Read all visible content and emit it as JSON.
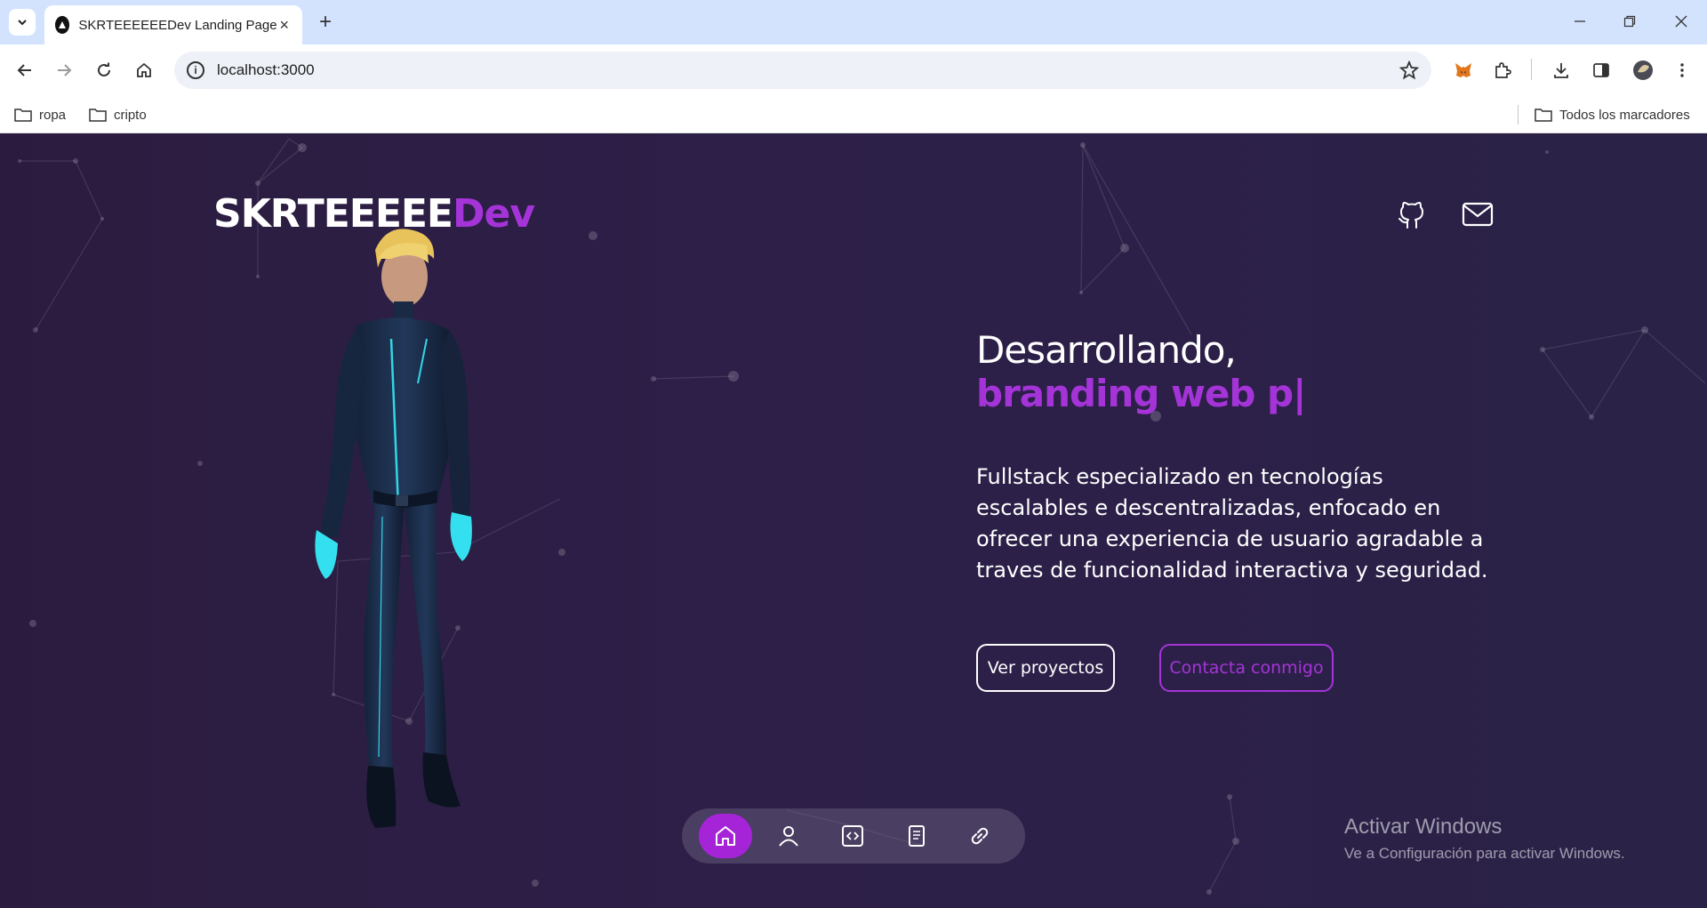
{
  "browser": {
    "tab_title": "SKRTEEEEEEDev Landing Page",
    "url": "localhost:3000",
    "bookmarks": [
      "ropa",
      "cripto"
    ],
    "all_bookmarks_label": "Todos los marcadores"
  },
  "site": {
    "logo_main": "SKRTEEEEE",
    "logo_accent": "Dev",
    "hero_title": "Desarrollando,",
    "hero_typing": "branding web p|",
    "hero_description": "Fullstack especializado en tecnologías escalables e descentralizadas, enfocado en ofrecer una experiencia de usuario agradable a traves de funcionalidad interactiva y seguridad.",
    "primary_button": "Ver proyectos",
    "secondary_button": "Contacta conmigo",
    "accent_color": "#a534d8",
    "dock_items": [
      "home-icon",
      "user-icon",
      "code-icon",
      "book-icon",
      "link-icon"
    ],
    "dock_active": "home-icon"
  },
  "os_overlay": {
    "title": "Activar Windows",
    "subtitle": "Ve a Configuración para activar Windows."
  }
}
